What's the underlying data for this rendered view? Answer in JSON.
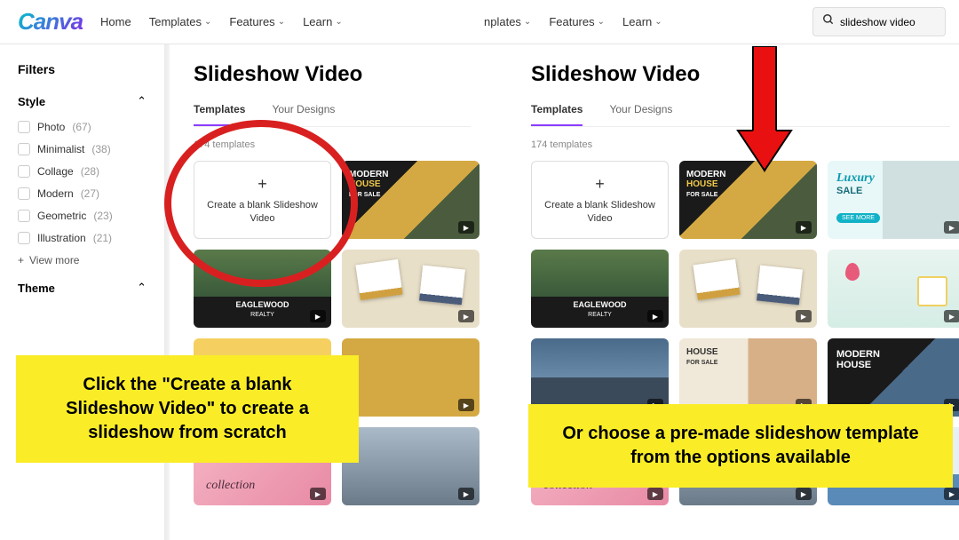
{
  "logo": "Canva",
  "nav": {
    "home": "Home",
    "templates": "Templates",
    "features": "Features",
    "learn": "Learn",
    "nplates": "nplates"
  },
  "search": {
    "value": "slideshow video"
  },
  "page_title": "Slideshow Video",
  "tabs": {
    "templates": "Templates",
    "designs": "Your Designs"
  },
  "template_count": "174 templates",
  "blank_card": "Create a blank Slideshow Video",
  "sidebar": {
    "title": "Filters",
    "style": "Style",
    "theme": "Theme",
    "view_more": "View more",
    "filters": [
      {
        "label": "Photo",
        "count": "(67)"
      },
      {
        "label": "Minimalist",
        "count": "(38)"
      },
      {
        "label": "Collage",
        "count": "(28)"
      },
      {
        "label": "Modern",
        "count": "(27)"
      },
      {
        "label": "Geometric",
        "count": "(23)"
      },
      {
        "label": "Illustration",
        "count": "(21)"
      }
    ]
  },
  "thumbs": {
    "house_modern": "MODERN",
    "house_big": "HOUSE",
    "house_sale": "FOR SALE",
    "luxury": "Luxury",
    "luxury_sale": "SALE",
    "see_more": "SEE MORE",
    "eagle1": "EAGLEWOOD",
    "eagle2": "REALTY",
    "modern": "MODERN",
    "house": "HOUSE",
    "collection": "collection"
  },
  "anno1": "Click the \"Create a blank Slideshow Video\" to create a slideshow from scratch",
  "anno2": "Or choose a pre-made slideshow template from the options available"
}
